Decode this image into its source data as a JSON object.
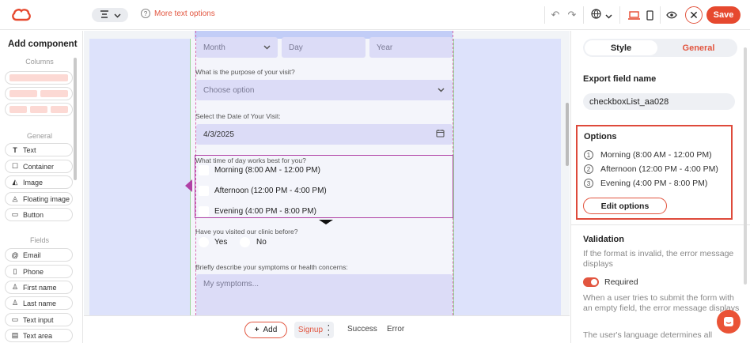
{
  "toolbar": {
    "more_text_options": "More text options",
    "save_label": "Save",
    "accent": "#e6492f"
  },
  "left": {
    "title": "Add component",
    "columns_label": "Columns",
    "general_label": "General",
    "fields_label": "Fields",
    "general_items": [
      {
        "icon": "text-icon",
        "label": "Text"
      },
      {
        "icon": "container-icon",
        "label": "Container"
      },
      {
        "icon": "image-icon",
        "label": "Image"
      },
      {
        "icon": "floating-image-icon",
        "label": "Floating image"
      },
      {
        "icon": "button-icon",
        "label": "Button"
      }
    ],
    "field_items": [
      {
        "icon": "at-icon",
        "label": "Email"
      },
      {
        "icon": "phone-icon",
        "label": "Phone"
      },
      {
        "icon": "person-icon",
        "label": "First name"
      },
      {
        "icon": "person-icon",
        "label": "Last name"
      },
      {
        "icon": "text-input-icon",
        "label": "Text input"
      },
      {
        "icon": "text-area-icon",
        "label": "Text area"
      }
    ]
  },
  "form": {
    "month": "Month",
    "day": "Day",
    "year": "Year",
    "purpose_label": "What is the purpose of your visit?",
    "purpose_placeholder": "Choose option",
    "date_label": "Select the Date of Your Visit:",
    "date_value": "4/3/2025",
    "time_label": "What time of day works best for you?",
    "time_options": [
      "Morning (8:00 AM - 12:00 PM)",
      "Afternoon (12:00 PM - 4:00 PM)",
      "Evening (4:00 PM - 8:00 PM)"
    ],
    "visited_label": "Have you visited our clinic before?",
    "yes": "Yes",
    "no": "No",
    "symptoms_label": "Briefly describe your symptoms or health concerns:",
    "symptoms_placeholder": "My symptoms..."
  },
  "bottom": {
    "add_label": "Add",
    "signup": "Signup",
    "success": "Success",
    "error": "Error"
  },
  "right": {
    "tab_style": "Style",
    "tab_general": "General",
    "export_title": "Export field name",
    "export_value": "checkboxList_aa028",
    "options_title": "Options",
    "options": [
      {
        "num": "1",
        "label": "Morning (8:00 AM - 12:00 PM)"
      },
      {
        "num": "2",
        "label": "Afternoon (12:00 PM - 4:00 PM)"
      },
      {
        "num": "3",
        "label": "Evening (4:00 PM - 8:00 PM)"
      }
    ],
    "edit_options": "Edit options",
    "validation_title": "Validation",
    "validation_desc": "If the format is invalid, the error message displays",
    "required_label": "Required",
    "required_desc": "When a user tries to submit the form with an empty field, the error message displays",
    "language_desc": "The user's language determines all"
  }
}
